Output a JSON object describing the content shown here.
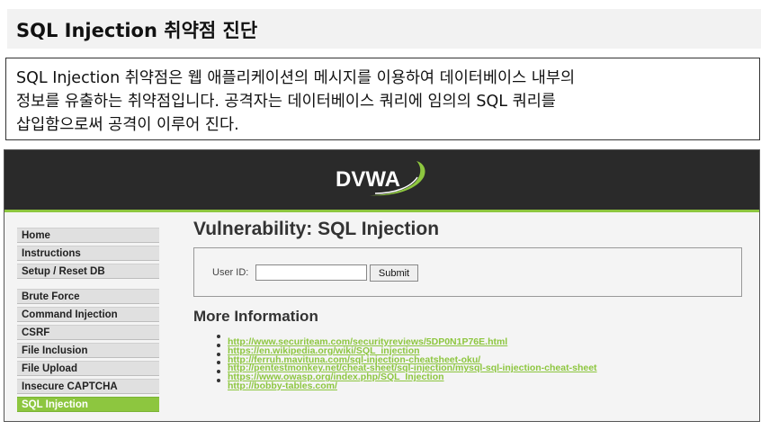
{
  "slide": {
    "title": "SQL Injection 취약점 진단",
    "description": [
      "SQL Injection 취약점은 웹 애플리케이션의 메시지를 이용하여 데이터베이스 내부의",
      "정보를 유출하는 취약점입니다. 공격자는 데이터베이스 쿼리에 임의의 SQL 쿼리를",
      "삽입함으로써 공격이 이루어 진다."
    ]
  },
  "dvwa": {
    "logo": "DVWA",
    "sidebar": {
      "group1": [
        "Home",
        "Instructions",
        "Setup / Reset DB"
      ],
      "group2": [
        "Brute Force",
        "Command Injection",
        "CSRF",
        "File Inclusion",
        "File Upload",
        "Insecure CAPTCHA",
        "SQL Injection"
      ],
      "active": "SQL Injection"
    },
    "main": {
      "title": "Vulnerability: SQL Injection",
      "form": {
        "label": "User ID:",
        "value": "",
        "submit": "Submit"
      },
      "more_info_title": "More Information",
      "links": [
        "http://www.securiteam.com/securityreviews/5DP0N1P76E.html",
        "https://en.wikipedia.org/wiki/SQL_injection",
        "http://ferruh.mavituna.com/sql-injection-cheatsheet-oku/",
        "http://pentestmonkey.net/cheat-sheet/sql-injection/mysql-sql-injection-cheat-sheet",
        "https://www.owasp.org/index.php/SQL_Injection",
        "http://bobby-tables.com/"
      ]
    },
    "colors": {
      "header_bg": "#2a2a2a",
      "accent_green": "#8dc63f",
      "menu_bg": "#e0e0e0"
    }
  }
}
